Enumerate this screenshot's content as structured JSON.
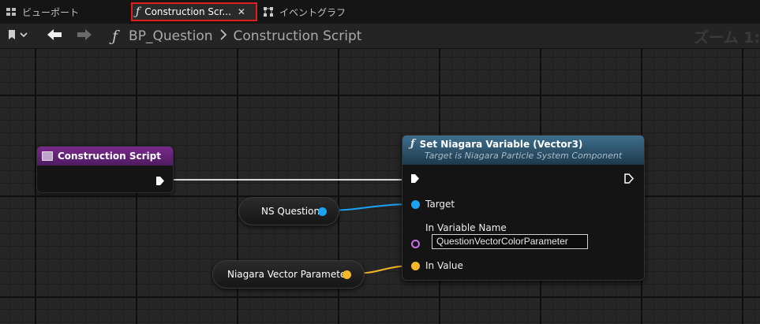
{
  "tabs": {
    "viewport": "ビューポート",
    "construction": "Construction Scr...",
    "event_graph": "イベントグラフ"
  },
  "toolbar": {
    "breadcrumb_blueprint": "BP_Question",
    "breadcrumb_graph": "Construction Script",
    "zoom": "ズーム 1:"
  },
  "nodes": {
    "construction_script": {
      "title": "Construction Script"
    },
    "set_niagara": {
      "title": "Set Niagara Variable (Vector3)",
      "subtitle": "Target is Niagara Particle System Component",
      "pin_target": "Target",
      "pin_variable_name": "In Variable Name",
      "variable_name_value": "QuestionVectorColorParameter",
      "pin_value": "In Value"
    },
    "ns_question": {
      "label": "NS Question"
    },
    "niagara_vector_parameter": {
      "label": "Niagara Vector Parameter"
    }
  },
  "colors": {
    "highlight_border": "#e01e1e",
    "event_header": "#7a2a8c",
    "function_header": "#3e6e8c",
    "object_pin": "#1aa3f5",
    "string_pin": "#c76fe8",
    "struct_pin": "#f4b828",
    "exec_pin": "#ffffff"
  },
  "icons": [
    "viewport-icon",
    "function-icon",
    "close-icon",
    "event-graph-icon",
    "bookmark-icon",
    "back-arrow-icon",
    "forward-arrow-icon",
    "event-icon",
    "exec-pin-icon"
  ]
}
